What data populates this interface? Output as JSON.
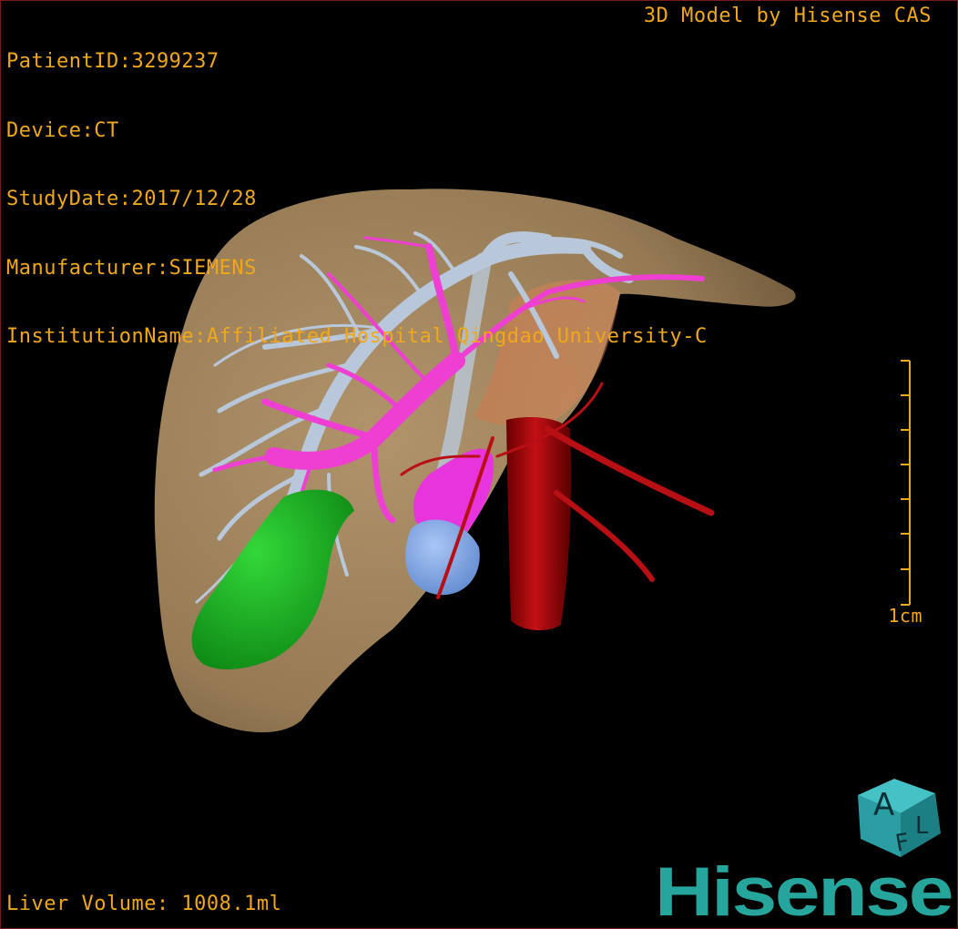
{
  "header": {
    "lines": [
      "PatientID:3299237",
      "Device:CT",
      "StudyDate:2017/12/28",
      "Manufacturer:SIEMENS",
      "InstitutionName:Affiliated Hospital Qingdao University-C"
    ],
    "credit": "3D Model by Hisense CAS"
  },
  "footer": {
    "volume": "Liver Volume: 1008.1ml"
  },
  "scale_bar": {
    "label": "1cm",
    "ticks": 7
  },
  "orientation_cube": {
    "face_top": "A",
    "face_left": "F",
    "face_right": "L"
  },
  "brand": {
    "name": "Hisense"
  },
  "colors": {
    "overlay_text": "#f0a81a",
    "liver": "#a2855f",
    "hepatic_vein": "#b8c8da",
    "portal_vein": "#ee3fd2",
    "artery": "#b80f14",
    "gallbladder": "#13b01b",
    "kidney_blue": "#7fa6e6",
    "cube": "#2fa0a5",
    "brand": "#26a59c"
  }
}
